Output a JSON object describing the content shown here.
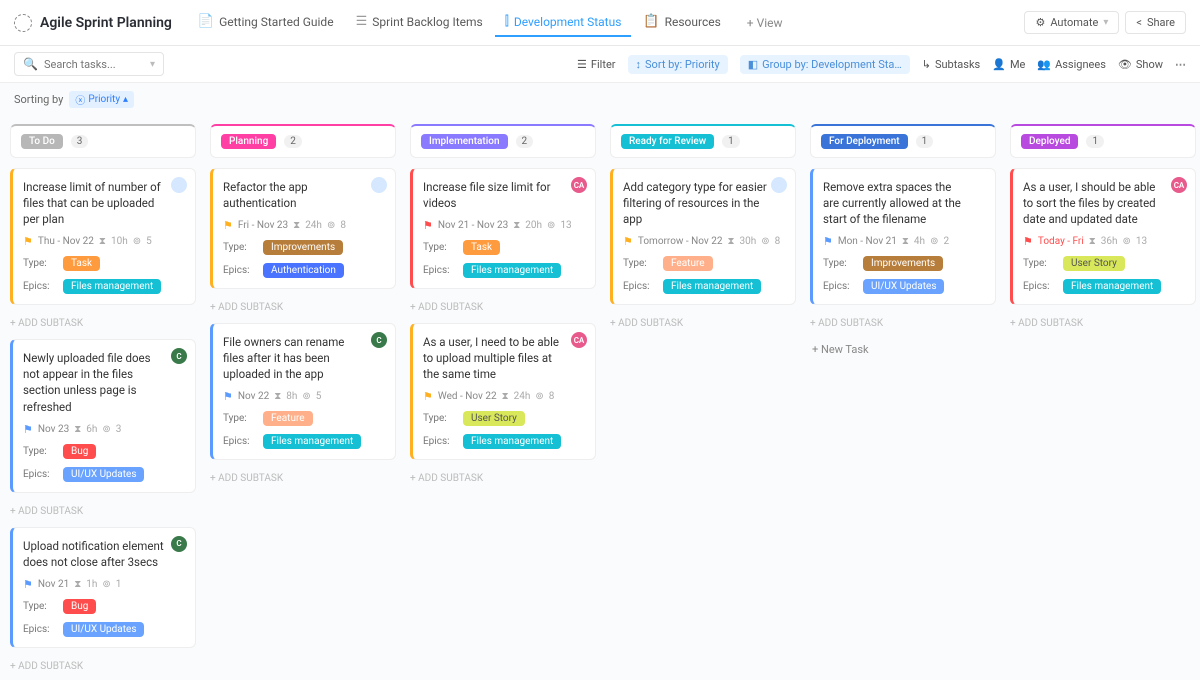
{
  "header": {
    "app_title": "Agile Sprint Planning",
    "tabs": [
      {
        "label": "Getting Started Guide"
      },
      {
        "label": "Sprint Backlog Items"
      },
      {
        "label": "Development Status",
        "active": true
      },
      {
        "label": "Resources"
      }
    ],
    "add_view": "+ View",
    "automate": "Automate",
    "share": "Share"
  },
  "toolbar": {
    "search_placeholder": "Search tasks...",
    "filter": "Filter",
    "sort": "Sort by: Priority",
    "group": "Group by: Development Sta…",
    "subtasks": "Subtasks",
    "me": "Me",
    "assignees": "Assignees",
    "show": "Show"
  },
  "sortbar": {
    "label": "Sorting by",
    "value": "Priority"
  },
  "columns": [
    {
      "name": "To Do",
      "color": "#b7b7b7",
      "border": "#bfbfbf",
      "count": "3",
      "cards": [
        {
          "title": "Increase limit of number of files that can be uploaded per plan",
          "border": "#ffb020",
          "flag": "#ffb020",
          "avatar": {
            "c": "#d5e8ff",
            "t": ""
          },
          "date": "Thu  -  Nov 22",
          "est": "10h",
          "sub": "5",
          "type": {
            "t": "Task",
            "c": "#ff9b3f"
          },
          "epic": {
            "t": "Files management",
            "c": "#15c0d4"
          }
        },
        {
          "title": "Newly uploaded file does not appear in the files section unless page is refreshed",
          "border": "#5b9bff",
          "flag": "#5b9bff",
          "avatar": {
            "c": "#3a7a4a",
            "t": "C"
          },
          "date": "Nov 23",
          "est": "6h",
          "sub": "3",
          "type": {
            "t": "Bug",
            "c": "#ff4d4d"
          },
          "epic": {
            "t": "UI/UX Updates",
            "c": "#6aa3ff"
          }
        },
        {
          "title": "Upload notification element does not close after 3secs",
          "border": "#5b9bff",
          "flag": "#5b9bff",
          "avatar": {
            "c": "#3a7a4a",
            "t": "C"
          },
          "date": "Nov 21",
          "est": "1h",
          "sub": "1",
          "type": {
            "t": "Bug",
            "c": "#ff4d4d"
          },
          "epic": {
            "t": "UI/UX Updates",
            "c": "#6aa3ff"
          }
        }
      ]
    },
    {
      "name": "Planning",
      "color": "#ff3fa4",
      "border": "#ff3fa4",
      "count": "2",
      "cards": [
        {
          "title": "Refactor the app authentication",
          "border": "#ffb020",
          "flag": "#ffb020",
          "avatar": {
            "c": "#d5e8ff",
            "t": ""
          },
          "date": "Fri  -  Nov 23",
          "est": "24h",
          "sub": "8",
          "type": {
            "t": "Improvements",
            "c": "#b77d3a"
          },
          "epic": {
            "t": "Authentication",
            "c": "#4a74ff"
          }
        },
        {
          "title": "File owners can rename files after it has been uploaded in the app",
          "border": "#5b9bff",
          "flag": "#5b9bff",
          "avatar": {
            "c": "#3a7a4a",
            "t": "C"
          },
          "date": "Nov 22",
          "est": "8h",
          "sub": "5",
          "type": {
            "t": "Feature",
            "c": "#ffb08a"
          },
          "epic": {
            "t": "Files management",
            "c": "#15c0d4"
          }
        }
      ]
    },
    {
      "name": "Implementation",
      "color": "#8a7aff",
      "border": "#8a7aff",
      "count": "2",
      "cards": [
        {
          "title": "Increase file size limit for videos",
          "border": "#ff4d4d",
          "flag": "#ff4d4d",
          "avatar": {
            "c": "#e85a8b",
            "t": "CA"
          },
          "date": "Nov 21  -  Nov 23",
          "est": "20h",
          "sub": "13",
          "type": {
            "t": "Task",
            "c": "#ff9b3f"
          },
          "epic": {
            "t": "Files management",
            "c": "#15c0d4"
          }
        },
        {
          "title": "As a user, I need to be able to upload multiple files at the same time",
          "border": "#ffb020",
          "flag": "#ffb020",
          "avatar": {
            "c": "#e85a8b",
            "t": "CA"
          },
          "date": "Wed  -  Nov 22",
          "est": "24h",
          "sub": "8",
          "type": {
            "t": "User Story",
            "c": "#d9e85a",
            "tc": "#555"
          },
          "epic": {
            "t": "Files management",
            "c": "#15c0d4"
          }
        }
      ]
    },
    {
      "name": "Ready for Review",
      "color": "#15c0d4",
      "border": "#15c0d4",
      "count": "1",
      "cards": [
        {
          "title": "Add category type for easier filtering of resources in the app",
          "border": "#ffb020",
          "flag": "#ffb020",
          "avatar": {
            "c": "#d5e8ff",
            "t": ""
          },
          "date": "Tomorrow  -  Nov 22",
          "est": "30h",
          "sub": "8",
          "type": {
            "t": "Feature",
            "c": "#ffb08a"
          },
          "epic": {
            "t": "Files management",
            "c": "#15c0d4"
          }
        }
      ]
    },
    {
      "name": "For Deployment",
      "color": "#3a74d9",
      "border": "#3a74d9",
      "count": "1",
      "cards": [
        {
          "title": "Remove extra spaces the are currently allowed at the start of the filename",
          "border": "#5b9bff",
          "flag": "#5b9bff",
          "date": "Mon  -  Nov 21",
          "est": "4h",
          "sub": "2",
          "type": {
            "t": "Improvements",
            "c": "#b77d3a"
          },
          "epic": {
            "t": "UI/UX Updates",
            "c": "#6aa3ff"
          }
        }
      ],
      "newtask": "+ New Task"
    },
    {
      "name": "Deployed",
      "color": "#b84ae0",
      "border": "#b84ae0",
      "count": "1",
      "cards": [
        {
          "title": "As a user, I should be able to sort the files by created date and updated date",
          "border": "#ff4d4d",
          "flag": "#ff4d4d",
          "avatar": {
            "c": "#e85a8b",
            "t": "CA"
          },
          "date": "Today  -  Fri",
          "dc": "#ff4d4d",
          "est": "36h",
          "sub": "13",
          "type": {
            "t": "User Story",
            "c": "#d9e85a",
            "tc": "#555"
          },
          "epic": {
            "t": "Files management",
            "c": "#15c0d4"
          }
        }
      ]
    }
  ],
  "labels": {
    "type": "Type:",
    "epics": "Epics:",
    "addsub": "+ ADD SUBTASK"
  }
}
